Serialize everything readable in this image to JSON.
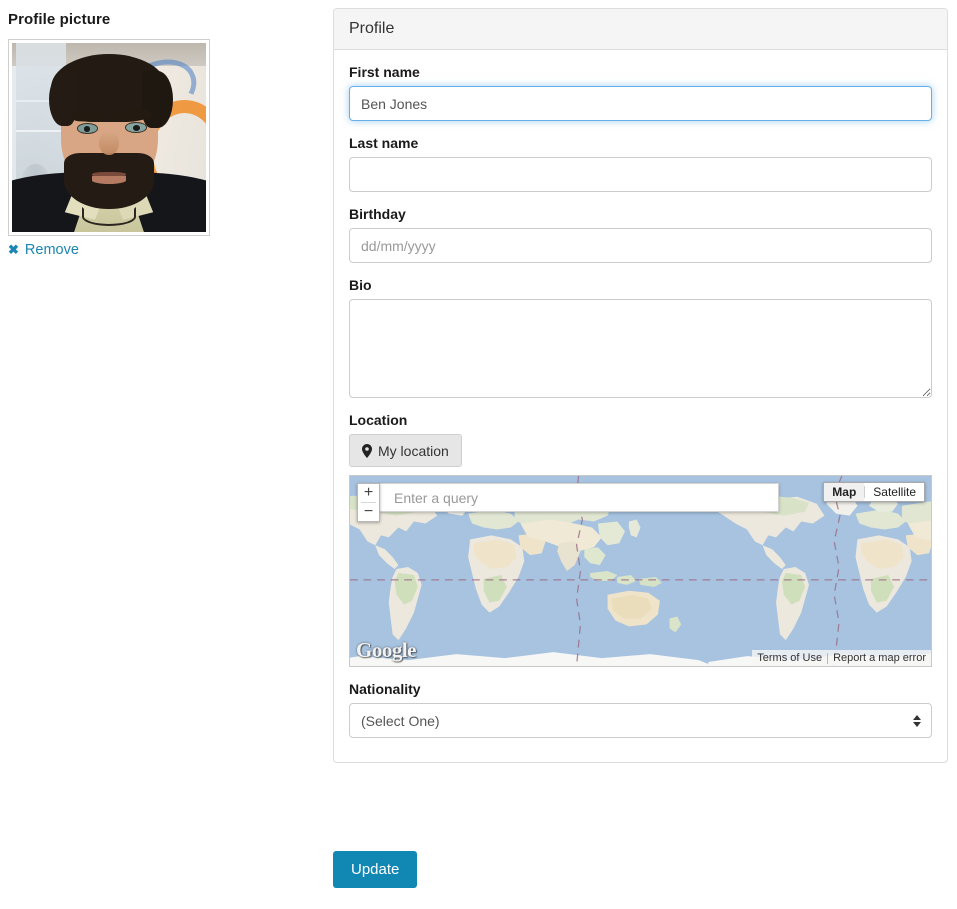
{
  "profile_picture": {
    "title": "Profile picture",
    "remove_label": "Remove",
    "remove_icon": "close-x-icon",
    "alt": "portrait photo of a bearded man in a dark suit"
  },
  "panel": {
    "header_title": "Profile",
    "fields": {
      "first_name": {
        "label": "First name",
        "value": "Ben Jones",
        "placeholder": "",
        "focused": true
      },
      "last_name": {
        "label": "Last name",
        "value": "",
        "placeholder": ""
      },
      "birthday": {
        "label": "Birthday",
        "value": "",
        "placeholder": "dd/mm/yyyy"
      },
      "bio": {
        "label": "Bio",
        "value": "",
        "placeholder": ""
      },
      "location": {
        "label": "Location",
        "my_location_button": "My location",
        "my_location_icon": "map-pin-icon"
      },
      "nationality": {
        "label": "Nationality",
        "selected": "(Select One)",
        "options": [
          "(Select One)"
        ]
      }
    }
  },
  "map": {
    "search_placeholder": "Enter a query",
    "search_value": "",
    "zoom_in_label": "+",
    "zoom_out_label": "−",
    "type_map_label": "Map",
    "type_satellite_label": "Satellite",
    "type_active": "Map",
    "logo_text": "Google",
    "terms_label": "Terms of Use",
    "report_label": "Report a map error"
  },
  "actions": {
    "update_label": "Update"
  },
  "colors": {
    "link_blue": "#1b86b3",
    "button_blue": "#1187b3",
    "focus_blue": "#66afe9",
    "panel_border": "#dddddd",
    "panel_header_bg": "#f5f5f5",
    "map_water": "#a5bfdd",
    "map_land": "#ece8dd",
    "map_green": "#c9d9bb"
  }
}
